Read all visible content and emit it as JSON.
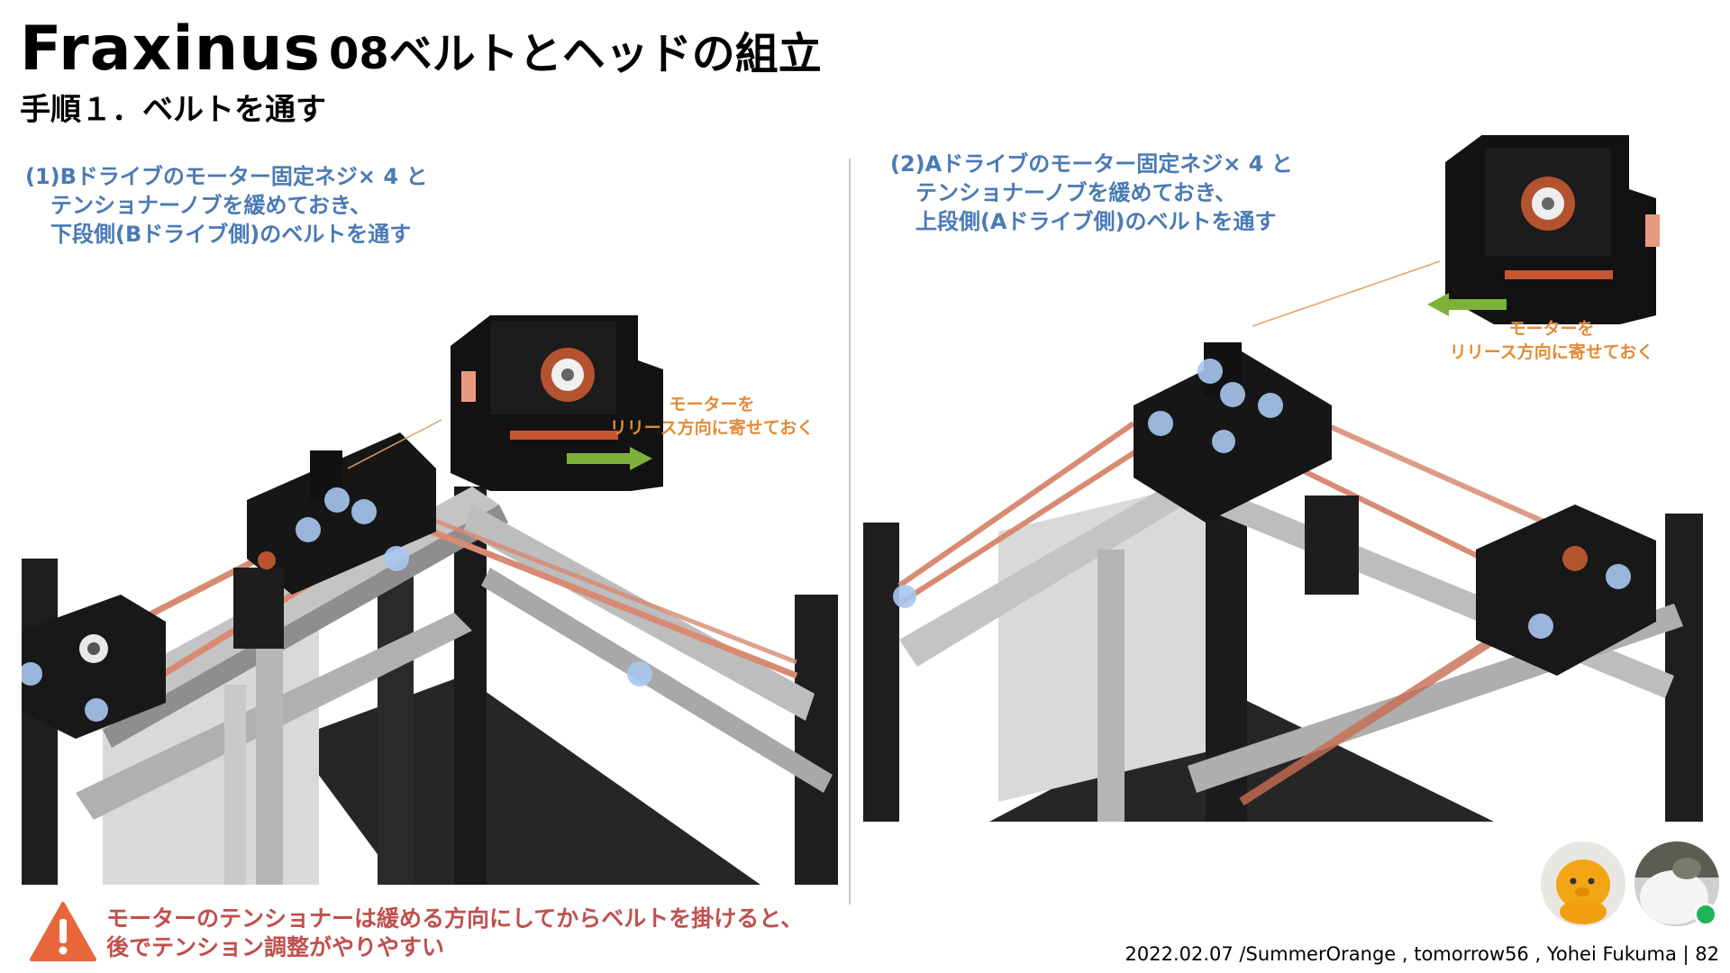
{
  "header": {
    "title": "Fraxinus",
    "subtitle": "08ベルトとヘッドの組立",
    "step": "手順１．ベルトを通す"
  },
  "panels": [
    {
      "instruction": [
        "(1)Bドライブのモーター固定ネジ× 4 と",
        "テンショナーノブを緩めておき、",
        "下段側(Bドライブ側)のベルトを通す"
      ],
      "note": [
        "モーターを",
        "リリース方向に寄せておく"
      ]
    },
    {
      "instruction": [
        "(2)Aドライブのモーター固定ネジ× 4 と",
        "テンショナーノブを緩めておき、",
        "上段側(Aドライブ側)のベルトを通す"
      ],
      "note": [
        "モーターを",
        "リリース方向に寄せておく"
      ]
    }
  ],
  "warning": {
    "icon": "warning-triangle-icon",
    "lines": [
      "モーターのテンショナーは緩める方向にしてからベルトを掛けると、",
      "後でテンション調整がやりやすい"
    ]
  },
  "footer": {
    "credit": "2022.02.07 /SummerOrange , tomorrow56 , Yohei Fukuma | 82"
  },
  "colors": {
    "instruction_blue": "#4a7ab5",
    "note_orange": "#e38b35",
    "warning_red": "#c0504d",
    "warning_triangle": "#e8673a",
    "arrow_green": "#7db13a",
    "belt": "#d88a72"
  }
}
